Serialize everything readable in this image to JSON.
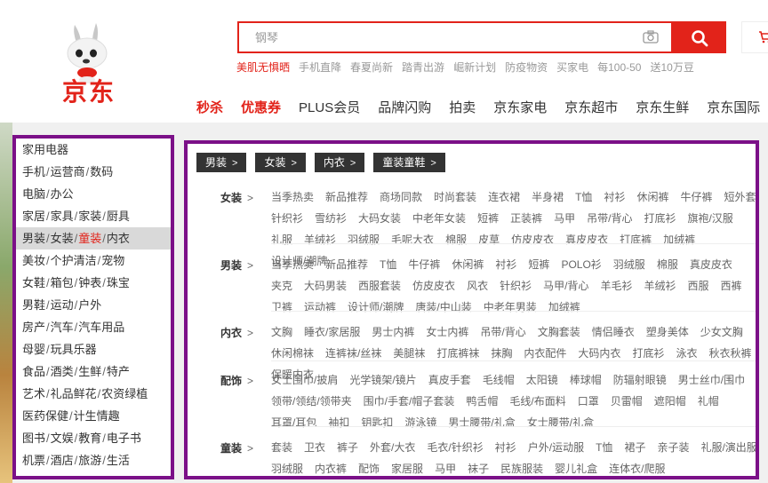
{
  "brand": {
    "name": "京东"
  },
  "search": {
    "placeholder": "钢琴"
  },
  "hotwords": [
    "美肌无惧晒",
    "手机直降",
    "春夏尚新",
    "踏青出游",
    "崛新计划",
    "防疫物资",
    "买家电",
    "每100-50",
    "送10万豆"
  ],
  "nav": [
    "秒杀",
    "优惠券",
    "PLUS会员",
    "品牌闪购",
    "拍卖",
    "京东家电",
    "京东超市",
    "京东生鲜",
    "京东国际"
  ],
  "categories": [
    [
      "家用电器"
    ],
    [
      "手机",
      "运营商",
      "数码"
    ],
    [
      "电脑",
      "办公"
    ],
    [
      "家居",
      "家具",
      "家装",
      "厨具"
    ],
    [
      "男装",
      "女装",
      "童装",
      "内衣"
    ],
    [
      "美妆",
      "个护清洁",
      "宠物"
    ],
    [
      "女鞋",
      "箱包",
      "钟表",
      "珠宝"
    ],
    [
      "男鞋",
      "运动",
      "户外"
    ],
    [
      "房产",
      "汽车",
      "汽车用品"
    ],
    [
      "母婴",
      "玩具乐器"
    ],
    [
      "食品",
      "酒类",
      "生鲜",
      "特产"
    ],
    [
      "艺术",
      "礼品鲜花",
      "农资绿植"
    ],
    [
      "医药保健",
      "计生情趣"
    ],
    [
      "图书",
      "文娱",
      "教育",
      "电子书"
    ],
    [
      "机票",
      "酒店",
      "旅游",
      "生活"
    ]
  ],
  "active_category_index": 4,
  "active_highlight": "童装",
  "tabs": [
    "男装",
    "女装",
    "内衣",
    "童装童鞋"
  ],
  "groups": [
    {
      "title": "女装",
      "items": [
        "当季热卖",
        "新品推荐",
        "商场同款",
        "时尚套装",
        "连衣裙",
        "半身裙",
        "T恤",
        "衬衫",
        "休闲裤",
        "牛仔裤",
        "短外套",
        "针织衫",
        "雪纺衫",
        "大码女装",
        "中老年女装",
        "短裤",
        "正装裤",
        "马甲",
        "吊带/背心",
        "打底衫",
        "旗袍/汉服",
        "礼服",
        "羊绒衫",
        "羽绒服",
        "毛呢大衣",
        "棉服",
        "皮草",
        "仿皮皮衣",
        "真皮皮衣",
        "打底裤",
        "加绒裤",
        "设计师/潮牌"
      ]
    },
    {
      "title": "男装",
      "items": [
        "当季热卖",
        "新品推荐",
        "T恤",
        "牛仔裤",
        "休闲裤",
        "衬衫",
        "短裤",
        "POLO衫",
        "羽绒服",
        "棉服",
        "真皮皮衣",
        "夹克",
        "大码男装",
        "西服套装",
        "仿皮皮衣",
        "风衣",
        "针织衫",
        "马甲/背心",
        "羊毛衫",
        "羊绒衫",
        "西服",
        "西裤",
        "卫裤",
        "运动裤",
        "设计师/潮牌",
        "唐装/中山装",
        "中老年男装",
        "加绒裤"
      ]
    },
    {
      "title": "内衣",
      "items": [
        "文胸",
        "睡衣/家居服",
        "男士内裤",
        "女士内裤",
        "吊带/背心",
        "文胸套装",
        "情侣睡衣",
        "塑身美体",
        "少女文胸",
        "休闲棉袜",
        "连裤袜/丝袜",
        "美腿袜",
        "打底裤袜",
        "抹胸",
        "内衣配件",
        "大码内衣",
        "打底衫",
        "泳衣",
        "秋衣秋裤",
        "保暖内衣"
      ]
    },
    {
      "title": "配饰",
      "items": [
        "女士围巾/披肩",
        "光学镜架/镜片",
        "真皮手套",
        "毛线帽",
        "太阳镜",
        "棒球帽",
        "防辐射眼镜",
        "男士丝巾/围巾",
        "领带/领结/领带夹",
        "围巾/手套/帽子套装",
        "鸭舌帽",
        "毛线/布面料",
        "口罩",
        "贝雷帽",
        "遮阳帽",
        "礼帽",
        "耳罩/耳包",
        "袖扣",
        "钥匙扣",
        "游泳镜",
        "男士腰带/礼盒",
        "女士腰带/礼盒"
      ]
    },
    {
      "title": "童装",
      "items": [
        "套装",
        "卫衣",
        "裤子",
        "外套/大衣",
        "毛衣/针织衫",
        "衬衫",
        "户外/运动服",
        "T恤",
        "裙子",
        "亲子装",
        "礼服/演出服",
        "羽绒服",
        "内衣裤",
        "配饰",
        "家居服",
        "马甲",
        "袜子",
        "民族服装",
        "婴儿礼盒",
        "连体衣/爬服"
      ]
    }
  ]
}
